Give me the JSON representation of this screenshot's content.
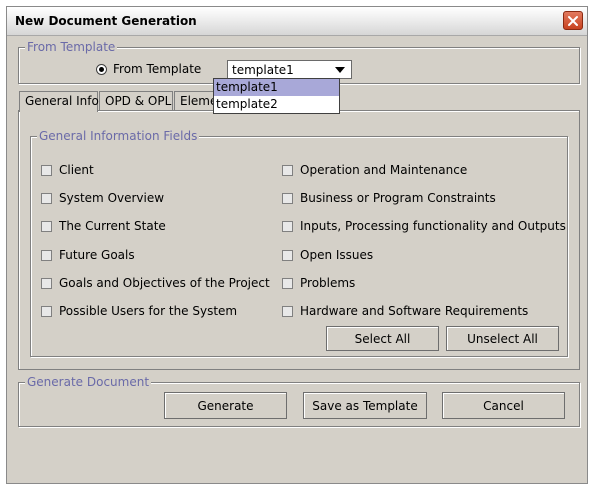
{
  "window": {
    "title": "New Document Generation"
  },
  "from_template": {
    "legend": "From Template",
    "radio_label": "From Template",
    "selected": "template1",
    "options": [
      "template1",
      "template2"
    ]
  },
  "tabs": [
    {
      "label": "General Info"
    },
    {
      "label": "OPD & OPL"
    },
    {
      "label": "Eleme"
    }
  ],
  "general_info": {
    "legend": "General Information Fields",
    "left_fields": [
      "Client",
      "System Overview",
      "The Current State",
      "Future Goals",
      "Goals and Objectives of the Project",
      "Possible Users for the System"
    ],
    "right_fields": [
      "Operation and Maintenance",
      "Business or Program Constraints",
      "Inputs, Processing functionality and Outputs",
      "Open Issues",
      "Problems",
      "Hardware and Software Requirements"
    ],
    "select_all": "Select All",
    "unselect_all": "Unselect All"
  },
  "generate_document": {
    "legend": "Generate Document",
    "generate": "Generate",
    "save_as_template": "Save as Template",
    "cancel": "Cancel"
  }
}
